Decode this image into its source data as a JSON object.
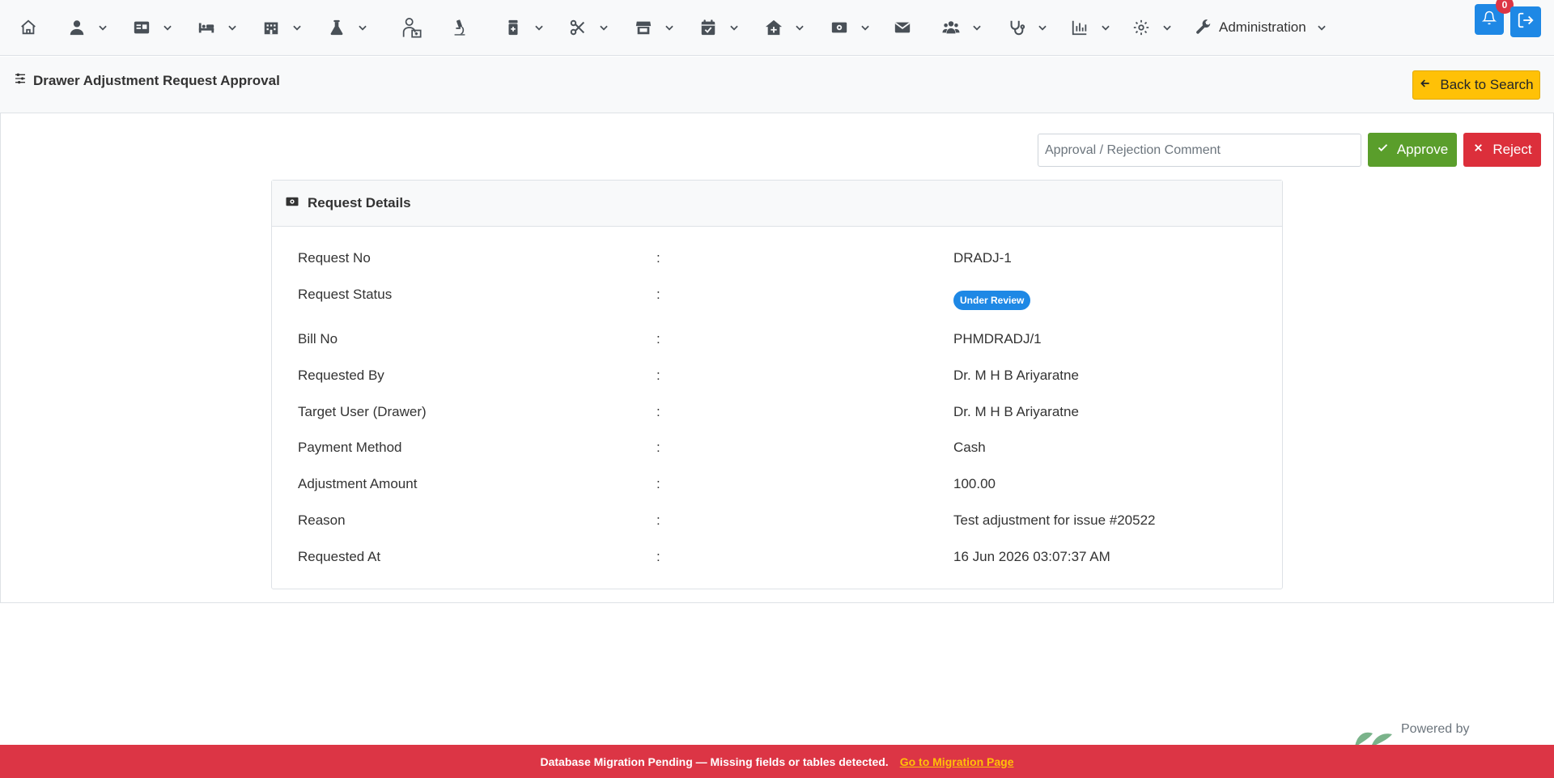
{
  "navbar": {
    "items": [
      {
        "icon": "home-icon",
        "dropdown": false
      },
      {
        "icon": "user-doctor-icon",
        "dropdown": true
      },
      {
        "icon": "id-card-icon",
        "dropdown": true
      },
      {
        "icon": "bed-icon",
        "dropdown": true
      },
      {
        "icon": "hospital-building-icon",
        "dropdown": true
      },
      {
        "icon": "flask-icon",
        "dropdown": true
      },
      {
        "icon": "doctor-desk-icon",
        "dropdown": false
      },
      {
        "icon": "microscope-icon",
        "dropdown": false
      },
      {
        "icon": "pharmacy-bottle-icon",
        "dropdown": true
      },
      {
        "icon": "scissors-icon",
        "dropdown": true
      },
      {
        "icon": "store-icon",
        "dropdown": true
      },
      {
        "icon": "calendar-check-icon",
        "dropdown": true
      },
      {
        "icon": "house-medical-icon",
        "dropdown": true
      },
      {
        "icon": "money-bill-icon",
        "dropdown": true
      },
      {
        "icon": "envelope-icon",
        "dropdown": false
      },
      {
        "icon": "users-icon",
        "dropdown": true
      },
      {
        "icon": "stethoscope-icon",
        "dropdown": true
      },
      {
        "icon": "chart-bar-icon",
        "dropdown": true
      },
      {
        "icon": "gear-icon",
        "dropdown": true
      }
    ],
    "admin_label": "Administration",
    "notification_count": "0"
  },
  "page": {
    "title": "Drawer Adjustment Request Approval",
    "back_label": "Back to Search"
  },
  "actions": {
    "comment_placeholder": "Approval / Rejection Comment",
    "approve_label": "Approve",
    "reject_label": "Reject"
  },
  "details": {
    "header": "Request Details",
    "separator": ":",
    "rows": [
      {
        "label": "Request No",
        "value": "DRADJ-1"
      },
      {
        "label": "Request Status",
        "value": "Under Review",
        "badge": true
      },
      {
        "label": "Bill No",
        "value": "PHMDRADJ/1"
      },
      {
        "label": "Requested By",
        "value": "Dr. M H B Ariyaratne"
      },
      {
        "label": "Target User (Drawer)",
        "value": "Dr. M H B Ariyaratne"
      },
      {
        "label": "Payment Method",
        "value": "Cash"
      },
      {
        "label": "Adjustment Amount",
        "value": "100.00"
      },
      {
        "label": "Reason",
        "value": "Test adjustment for issue #20522"
      },
      {
        "label": "Requested At",
        "value": "16 Jun 2026 03:07:37 AM"
      }
    ]
  },
  "footer": {
    "powered_by": "Powered by",
    "migration_message": "Database Migration Pending — Missing fields or tables detected.",
    "migration_link": "Go to Migration Page"
  },
  "colors": {
    "primary": "#1e88e5",
    "warning": "#ffc107",
    "success": "#5a9e2b",
    "danger": "#dc3545"
  }
}
